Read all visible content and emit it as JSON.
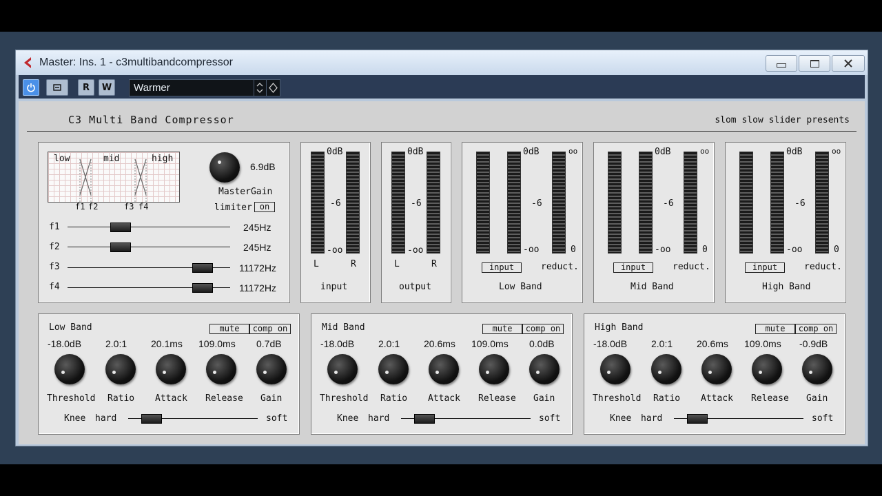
{
  "window": {
    "title": "Master: Ins. 1 - c3multibandcompressor"
  },
  "toolbar": {
    "read_label": "R",
    "write_label": "W",
    "preset_name": "Warmer"
  },
  "plugin": {
    "title": "C3 Multi Band Compressor",
    "subtitle": "slom slow slider presents"
  },
  "crossover": {
    "graph_labels": {
      "low": "low",
      "mid": "mid",
      "high": "high",
      "f1": "f1",
      "f2": "f2",
      "f3": "f3",
      "f4": "f4"
    },
    "master_gain_value": "6.9dB",
    "master_gain_label": "MasterGain",
    "limiter_label": "limiter",
    "limiter_state": "on",
    "f1": {
      "label": "f1",
      "value": "245Hz"
    },
    "f2": {
      "label": "f2",
      "value": "245Hz"
    },
    "f3": {
      "label": "f3",
      "value": "11172Hz"
    },
    "f4": {
      "label": "f4",
      "value": "11172Hz"
    }
  },
  "meter_scale": {
    "top": "0dB",
    "mid": "-6",
    "bottom": "-oo",
    "red_top": "oo",
    "red_bottom": "0"
  },
  "meters": {
    "input": {
      "name": "input",
      "l": "L",
      "r": "R"
    },
    "output": {
      "name": "output",
      "l": "L",
      "r": "R"
    },
    "low": {
      "name": "Low Band",
      "input_label": "input",
      "reduct_label": "reduct."
    },
    "mid": {
      "name": "Mid Band",
      "input_label": "input",
      "reduct_label": "reduct."
    },
    "high": {
      "name": "High Band",
      "input_label": "input",
      "reduct_label": "reduct."
    }
  },
  "bands": [
    {
      "name": "Low Band",
      "mute": "mute",
      "comp": "comp on",
      "threshold": "-18.0dB",
      "ratio": "2.0:1",
      "attack": "20.1ms",
      "release": "109.0ms",
      "gain": "0.7dB",
      "labels": {
        "threshold": "Threshold",
        "ratio": "Ratio",
        "attack": "Attack",
        "release": "Release",
        "gain": "Gain"
      },
      "knee": {
        "label": "Knee",
        "hard": "hard",
        "soft": "soft",
        "position": 0.12
      }
    },
    {
      "name": "Mid Band",
      "mute": "mute",
      "comp": "comp on",
      "threshold": "-18.0dB",
      "ratio": "2.0:1",
      "attack": "20.6ms",
      "release": "109.0ms",
      "gain": "0.0dB",
      "labels": {
        "threshold": "Threshold",
        "ratio": "Ratio",
        "attack": "Attack",
        "release": "Release",
        "gain": "Gain"
      },
      "knee": {
        "label": "Knee",
        "hard": "hard",
        "soft": "soft",
        "position": 0.12
      }
    },
    {
      "name": "High Band",
      "mute": "mute",
      "comp": "comp on",
      "threshold": "-18.0dB",
      "ratio": "2.0:1",
      "attack": "20.6ms",
      "release": "109.0ms",
      "gain": "-0.9dB",
      "labels": {
        "threshold": "Threshold",
        "ratio": "Ratio",
        "attack": "Attack",
        "release": "Release",
        "gain": "Gain"
      },
      "knee": {
        "label": "Knee",
        "hard": "hard",
        "soft": "soft",
        "position": 0.12
      }
    }
  ],
  "colors": {
    "accent": "#c0282d",
    "panel": "#e7e7e7",
    "plugin_bg": "#d2d2d2",
    "titlebar": "#c9d9ec"
  },
  "icons": {
    "app": "cubase-icon",
    "power": "power-icon",
    "bypass": "bypass-icon",
    "minimize": "minimize-icon",
    "maximize": "maximize-icon",
    "close": "close-icon"
  }
}
